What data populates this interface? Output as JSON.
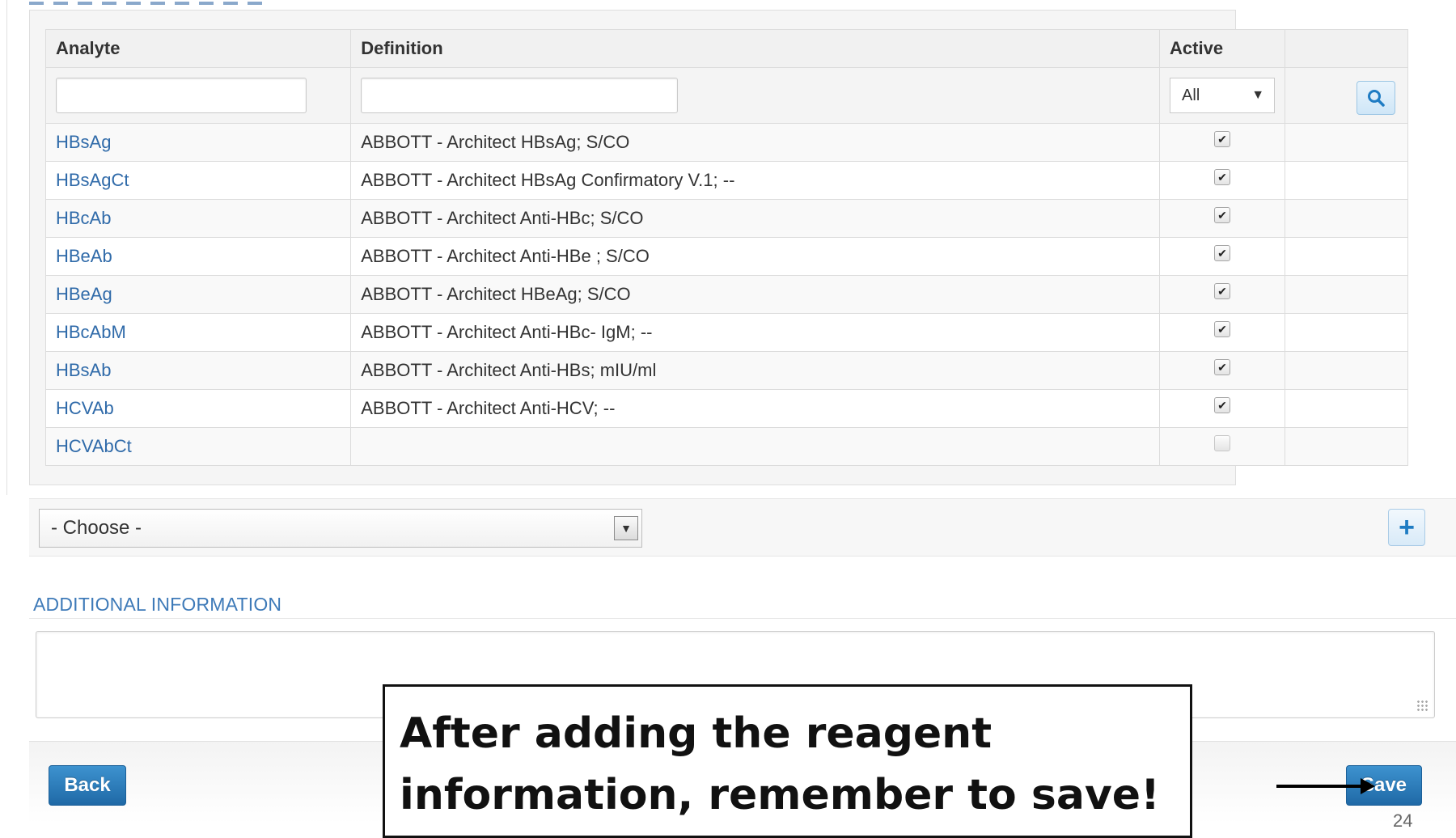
{
  "table": {
    "headers": {
      "analyte": "Analyte",
      "definition": "Definition",
      "active": "Active"
    },
    "active_filter_value": "All",
    "rows": [
      {
        "analyte": "HBsAg",
        "definition": "ABBOTT - Architect HBsAg; S/CO",
        "active": true
      },
      {
        "analyte": "HBsAgCt",
        "definition": "ABBOTT - Architect HBsAg Confirmatory V.1; --",
        "active": true
      },
      {
        "analyte": "HBcAb",
        "definition": "ABBOTT - Architect Anti-HBc; S/CO",
        "active": true
      },
      {
        "analyte": "HBeAb",
        "definition": "ABBOTT - Architect Anti-HBe ; S/CO",
        "active": true
      },
      {
        "analyte": "HBeAg",
        "definition": "ABBOTT - Architect HBeAg; S/CO",
        "active": true
      },
      {
        "analyte": "HBcAbM",
        "definition": "ABBOTT - Architect Anti-HBc- IgM; --",
        "active": true
      },
      {
        "analyte": "HBsAb",
        "definition": "ABBOTT - Architect Anti-HBs; mIU/ml",
        "active": true
      },
      {
        "analyte": "HCVAb",
        "definition": "ABBOTT - Architect Anti-HCV; --",
        "active": true
      },
      {
        "analyte": "HCVAbCt",
        "definition": "",
        "active": false
      }
    ]
  },
  "choose_select": {
    "value": "- Choose -"
  },
  "additional_info": {
    "title": "ADDITIONAL INFORMATION",
    "value": ""
  },
  "buttons": {
    "back": "Back",
    "save": "Save"
  },
  "callout": {
    "line1": "After adding the reagent",
    "line2": "information, remember to save!"
  },
  "page_number": "24",
  "colors": {
    "link": "#2f6aa9",
    "primary_button": "#2a7bbd",
    "section_title": "#3e7ab8"
  }
}
